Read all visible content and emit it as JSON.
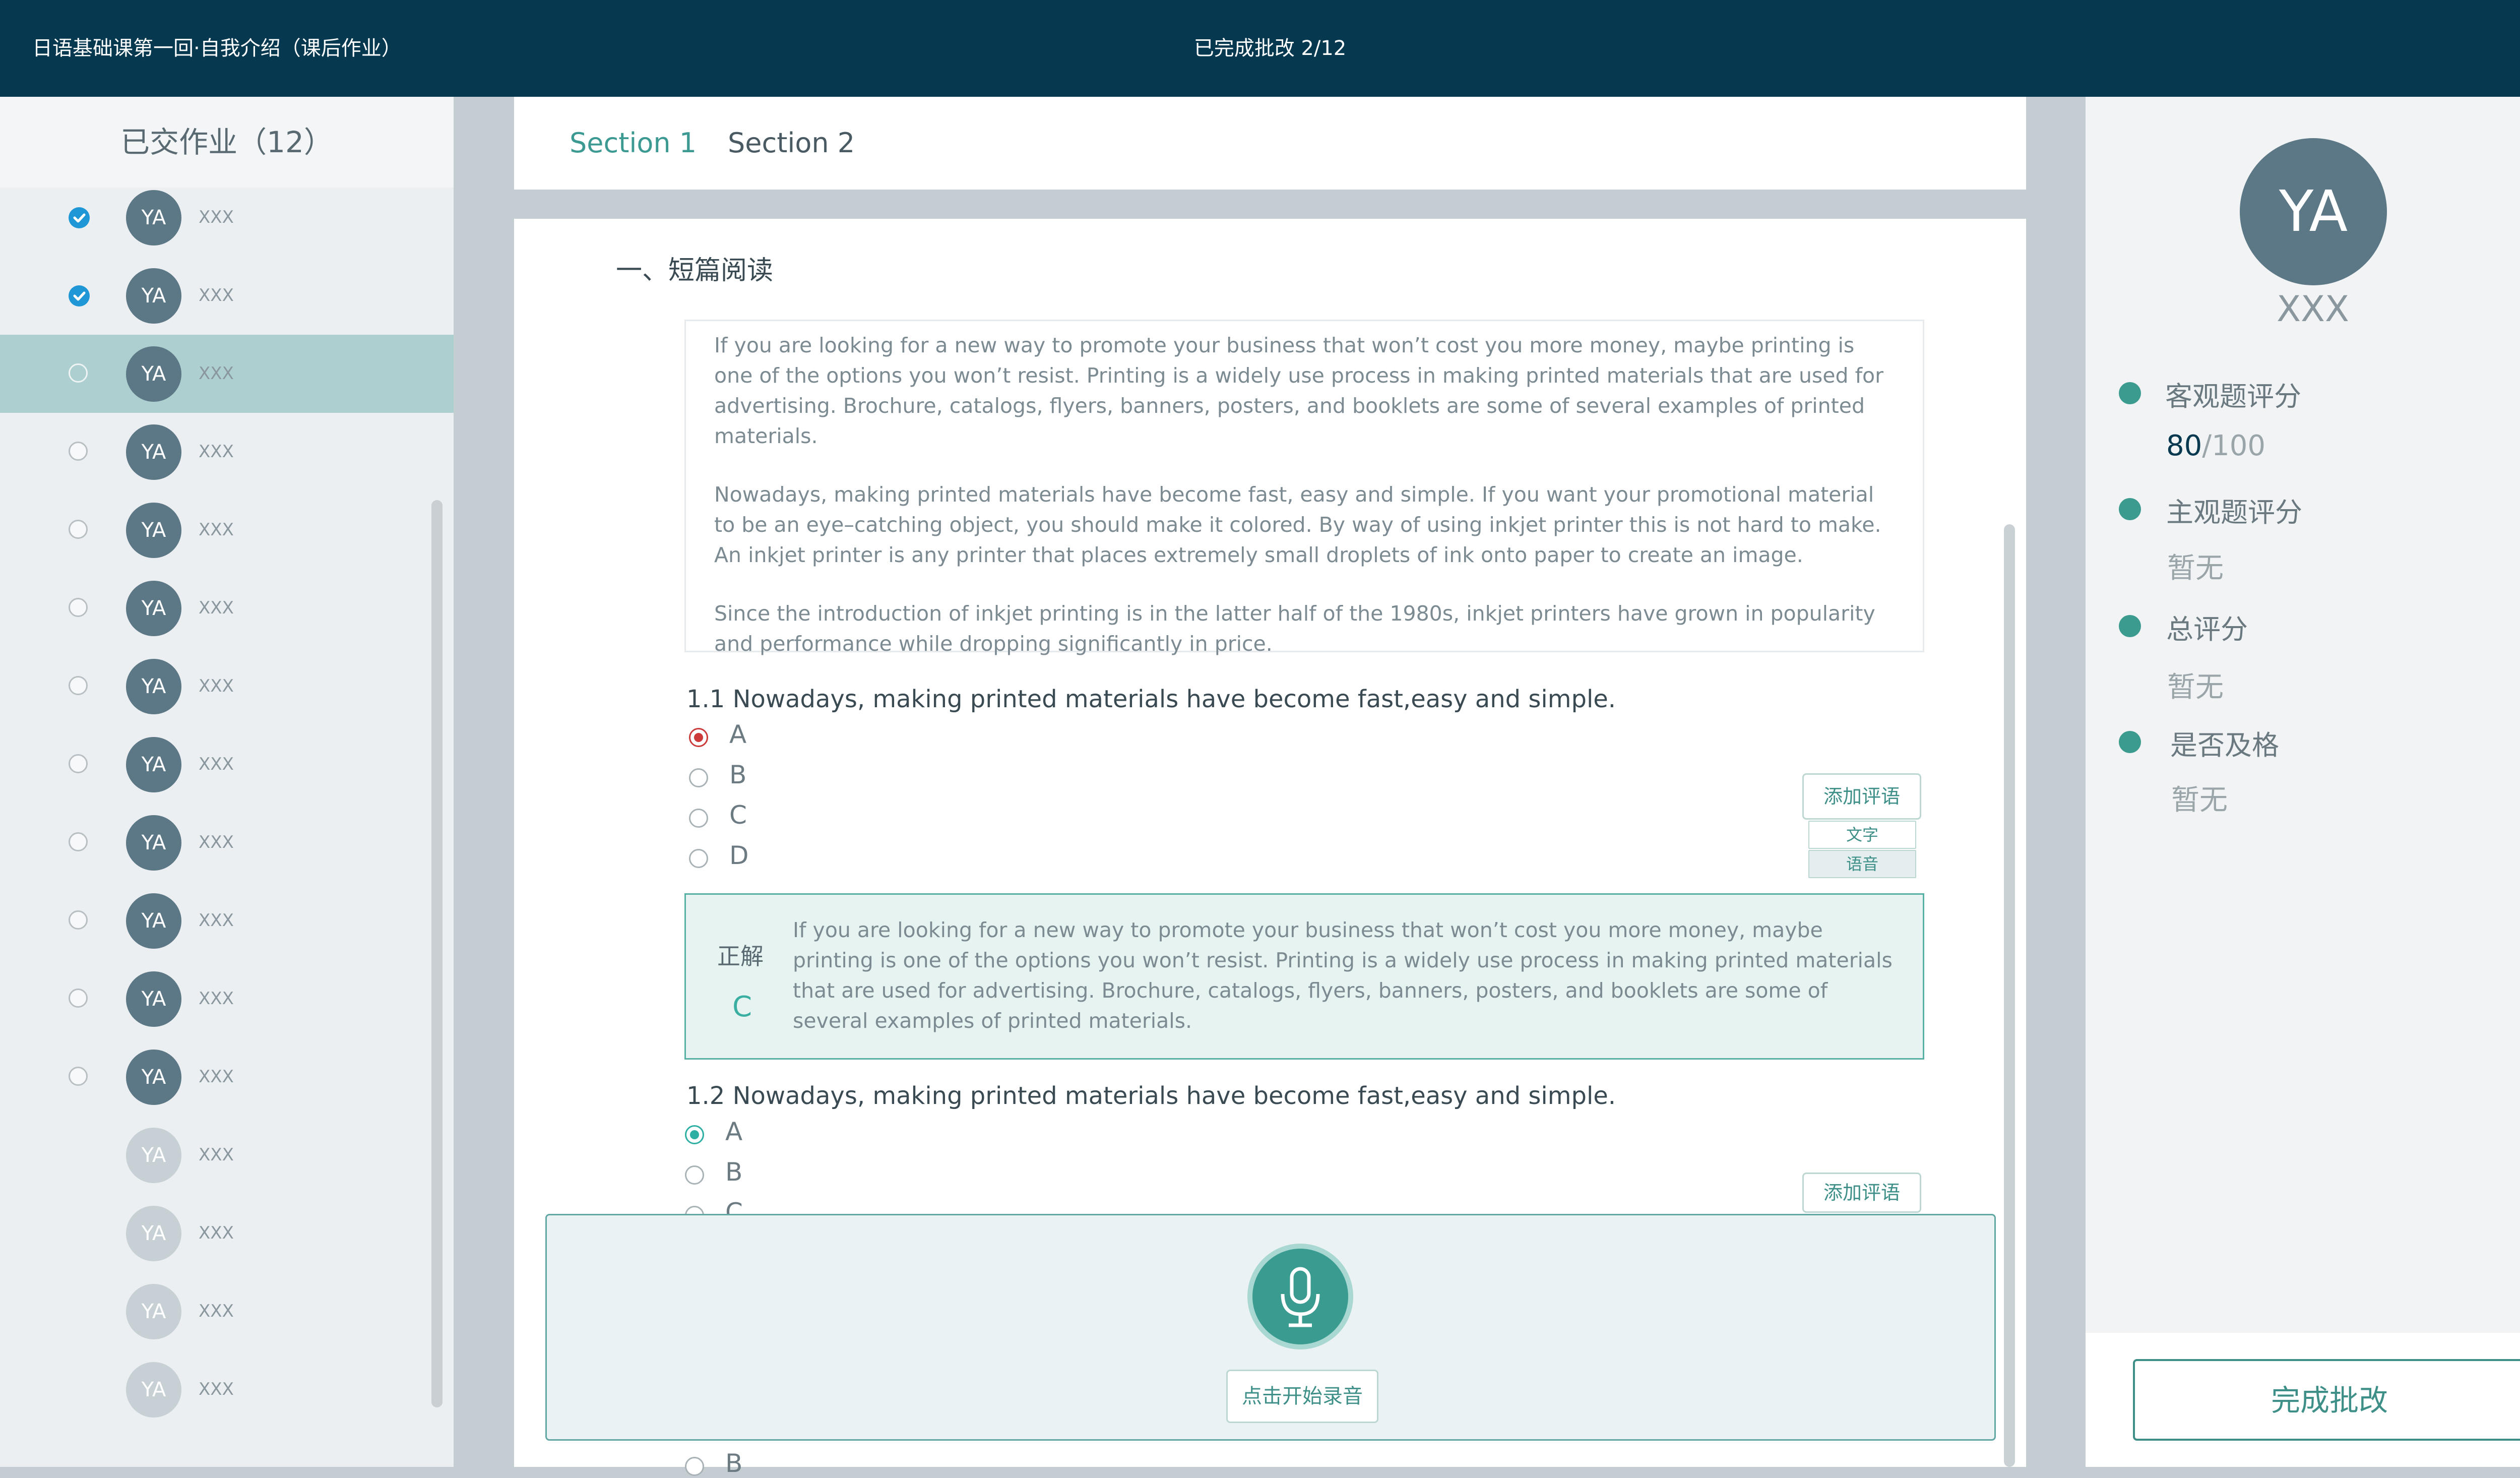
{
  "topbar": {
    "title": "日语基础课第一回·自我介绍（课后作业）",
    "progress": "已完成批改 2/12"
  },
  "sidebar": {
    "header": "已交作业（12）",
    "students": [
      {
        "initials": "YA",
        "name": "XXX",
        "status": "checked"
      },
      {
        "initials": "YA",
        "name": "XXX",
        "status": "checked"
      },
      {
        "initials": "YA",
        "name": "XXX",
        "status": "selected"
      },
      {
        "initials": "YA",
        "name": "XXX",
        "status": "unchecked"
      },
      {
        "initials": "YA",
        "name": "XXX",
        "status": "unchecked"
      },
      {
        "initials": "YA",
        "name": "XXX",
        "status": "unchecked"
      },
      {
        "initials": "YA",
        "name": "XXX",
        "status": "unchecked"
      },
      {
        "initials": "YA",
        "name": "XXX",
        "status": "unchecked"
      },
      {
        "initials": "YA",
        "name": "XXX",
        "status": "unchecked"
      },
      {
        "initials": "YA",
        "name": "XXX",
        "status": "unchecked"
      },
      {
        "initials": "YA",
        "name": "XXX",
        "status": "unchecked"
      },
      {
        "initials": "YA",
        "name": "XXX",
        "status": "unchecked"
      },
      {
        "initials": "YA",
        "name": "XXX",
        "status": "not-submitted"
      },
      {
        "initials": "YA",
        "name": "XXX",
        "status": "not-submitted"
      },
      {
        "initials": "YA",
        "name": "XXX",
        "status": "not-submitted"
      },
      {
        "initials": "YA",
        "name": "XXX",
        "status": "not-submitted"
      }
    ]
  },
  "tabs": [
    "Section 1",
    "Section 2"
  ],
  "section": {
    "title": "一、短篇阅读",
    "passage": [
      "If you are looking for a new way to promote your business that won’t cost you more money, maybe printing is one of the options you won’t resist. Printing is a widely use process in making printed materials that are used for advertising. Brochure, catalogs, flyers, banners, posters, and booklets are some of several examples of printed materials.",
      "Nowadays, making printed materials have become fast, easy and simple. If you want your promotional material to be an eye–catching object, you should make it colored. By way of using inkjet printer this is not hard to make. An inkjet printer is any printer that places extremely small droplets of ink onto paper to create an image.",
      "Since the introduction of inkjet printing is in the latter half of the 1980s, inkjet printers have grown in popularity and performance while dropping significantly in price."
    ]
  },
  "q1": {
    "text": "1.1 Nowadays, making printed materials have become fast,easy and simple.",
    "options": [
      "A",
      "B",
      "C",
      "D"
    ],
    "selected": "A",
    "add_comment": "添加评语",
    "comment_types": [
      "文字",
      "语音"
    ],
    "answer_label": "正解",
    "answer_value": "C",
    "answer_text": "If you are looking for a new way to promote your business that won’t cost you more money, maybe printing is one of the options you won’t resist. Printing is a widely use process in making printed materials that are used for advertising. Brochure, catalogs, flyers, banners, posters, and booklets are some of several examples of printed materials."
  },
  "q2": {
    "text": "1.2 Nowadays, making printed materials have become fast,easy and simple.",
    "options": [
      "A",
      "B",
      "C"
    ],
    "selected": "A",
    "add_comment": "添加评语",
    "bottom_option": "B"
  },
  "recorder": {
    "button": "点击开始录音"
  },
  "grading": {
    "initials": "YA",
    "name": "XXX",
    "objective_label": "客观题评分",
    "objective_score": "80",
    "objective_max": "/100",
    "subjective_label": "主观题评分",
    "subjective_value": "暂无",
    "total_label": "总评分",
    "total_value": "暂无",
    "pass_label": "是否及格",
    "pass_value": "暂无",
    "finish_button": "完成批改"
  },
  "colors": {
    "topbar": "#06394f",
    "accent": "#3c9b8f",
    "selected_row": "#adcfcf",
    "check": "#1f97d6",
    "wrong": "#cd3a3a"
  }
}
